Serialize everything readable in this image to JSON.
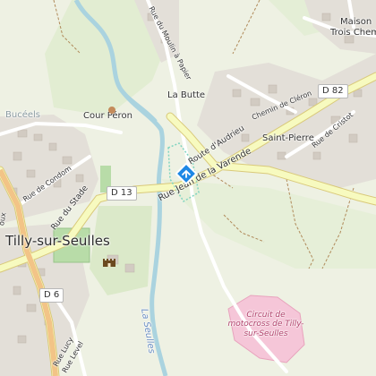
{
  "places": {
    "tilly": "Tilly-sur-Seulles",
    "la_butte": "La Butte",
    "cour_peron": "Cour Péron",
    "saint_pierre": "Saint-Pierre",
    "maison": "Maison",
    "trois_chem": "Trois Chem",
    "buceels": "Bucéels"
  },
  "streets": {
    "route_audrieu": "Route d'Audrieu",
    "rue_varende": "Rue Jean de la Varende",
    "rue_stade": "Rue du Stade",
    "rue_condom": "Rue de Condom",
    "rue_moulin": "Rue du Moulin à Papier",
    "chemin_cleron": "Chemin de Cléron",
    "rue_cristot": "Rue de Cristot",
    "rue_lucy": "Rue Lucy",
    "rue_level": "Rue Level",
    "oux": "oux"
  },
  "roads": {
    "d13": "D 13",
    "d82": "D 82",
    "d6": "D 6"
  },
  "water": {
    "la_seulles": "La Seulles"
  },
  "poi": {
    "circuit": "Circuit de motocross de Tilly-sur-Seulles",
    "marker_icon": "diamond-arrow-icon",
    "castle_icon": "castle-icon"
  },
  "colors": {
    "road_yellow": "#f7fabf",
    "road_casing": "#d9c97a",
    "river": "#aad3df",
    "built": "#e0dcd6",
    "green": "#d7e8c4",
    "marker": "#1e88e5",
    "circuit": "#f5c6d8"
  }
}
